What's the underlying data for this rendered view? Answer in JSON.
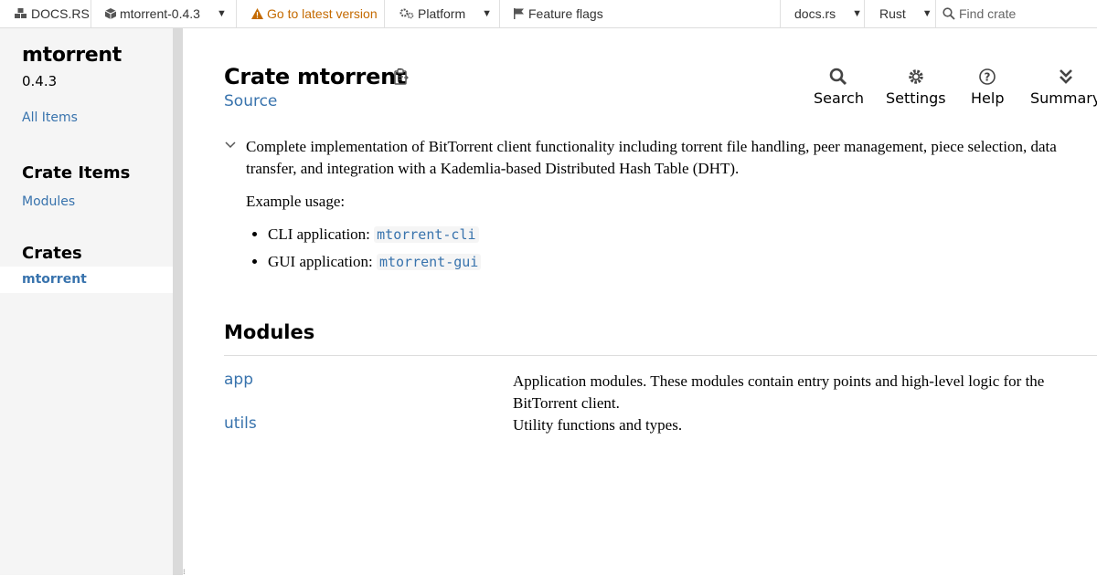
{
  "topnav": {
    "logo_label": "DOCS.RS",
    "crate_label": "mtorrent-0.4.3",
    "latest_label": "Go to latest version",
    "platform_label": "Platform",
    "feature_flags_label": "Feature flags",
    "docsrs_menu_label": "docs.rs",
    "rust_menu_label": "Rust",
    "search_placeholder": "Find crate",
    "warn_color": "#c46a00"
  },
  "sidebar": {
    "crate_name": "mtorrent",
    "version": "0.4.3",
    "all_items_label": "All Items",
    "crate_items_heading": "Crate Items",
    "modules_link_label": "Modules",
    "crates_heading": "Crates",
    "current_crate": "mtorrent"
  },
  "main": {
    "title": "Crate mtorrent",
    "source_label": "Source",
    "toolbar": {
      "search_label": "Search",
      "settings_label": "Settings",
      "help_label": "Help",
      "summary_label": "Summary"
    },
    "description": "Complete implementation of BitTorrent client functionality including torrent file handling, peer management, piece selection, data transfer, and integration with a Kademlia-based Distributed Hash Table (DHT).",
    "example_heading": "Example usage:",
    "examples": [
      {
        "prefix": "CLI application: ",
        "code": "mtorrent-cli"
      },
      {
        "prefix": "GUI application: ",
        "code": "mtorrent-gui"
      }
    ],
    "modules_heading": "Modules",
    "modules": [
      {
        "name": "app",
        "desc": "Application modules. These modules contain entry points and high-level logic for the BitTorrent client."
      },
      {
        "name": "utils",
        "desc": "Utility functions and types."
      }
    ],
    "link_color": "#3873ad"
  }
}
